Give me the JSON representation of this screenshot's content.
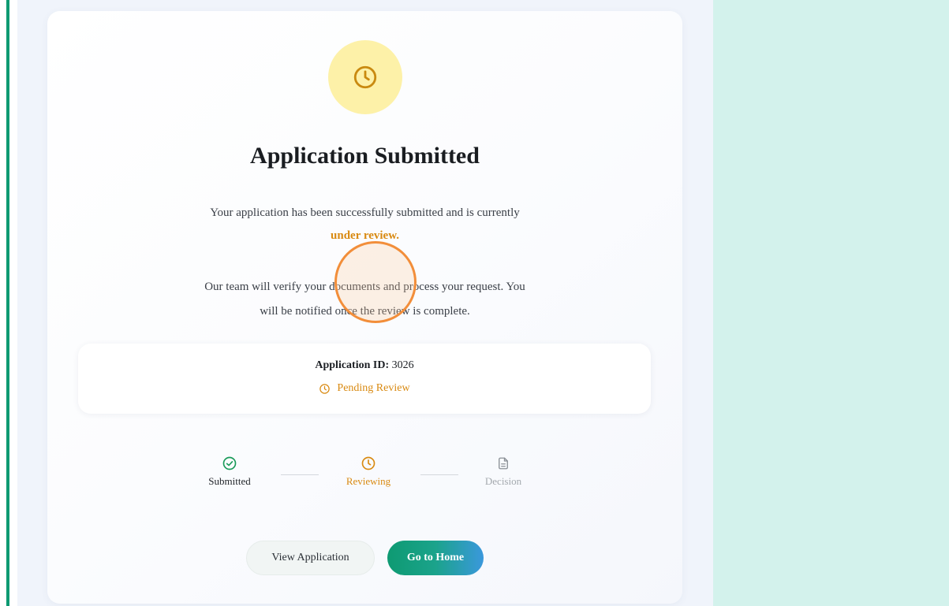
{
  "main": {
    "title": "Application Submitted",
    "description_prefix": "Your application has been successfully submitted and is currently",
    "description_highlight": "under review.",
    "note_line1": "Our team will verify your documents and process your request. You",
    "note_line2": "will be notified once the review is complete."
  },
  "application": {
    "id_label": "Application ID:",
    "id_value": "3026",
    "status": "Pending Review"
  },
  "steps": [
    {
      "label": "Submitted",
      "icon": "check-circle-icon",
      "color": "#1a9b5a"
    },
    {
      "label": "Reviewing",
      "icon": "clock-icon",
      "color": "#d98a12"
    },
    {
      "label": "Decision",
      "icon": "document-icon",
      "color": "#9aa0a6"
    }
  ],
  "buttons": {
    "view_application": "View Application",
    "go_home": "Go to Home"
  },
  "colors": {
    "accent_green": "#0e9a72",
    "warning": "#d98a12",
    "status_circle_bg": "#fdf1a8",
    "right_panel": "#d3f2ec"
  }
}
